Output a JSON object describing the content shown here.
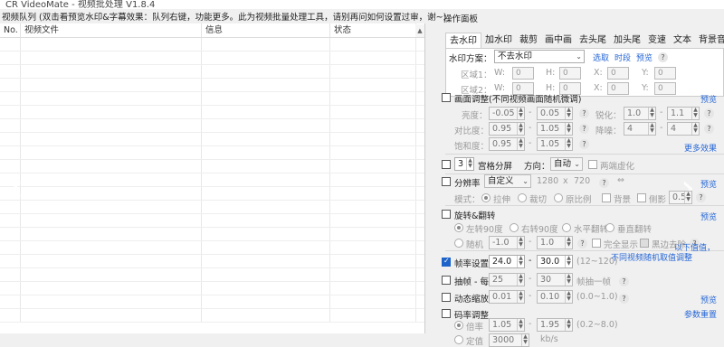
{
  "window": {
    "title": "CR VideoMate - 视频批处理 V1.8.4"
  },
  "queue": {
    "caption": "视频队列 (双击看预览水印&字幕效果：队列右键，功能更多。此为视频批量处理工具，请别再问如何设置过审，谢~)",
    "columns": [
      "No.",
      "视频文件",
      "信息",
      "状态"
    ]
  },
  "panel": {
    "caption": "操作面板",
    "tabs": [
      "去水印",
      "加水印",
      "裁剪",
      "画中画",
      "去头尾",
      "加头尾",
      "变速",
      "文本",
      "背景音"
    ],
    "watermark": {
      "scheme_label": "水印方案：",
      "scheme_value": "不去水印",
      "links": [
        "选取",
        "时段",
        "预览"
      ],
      "area1": "区域1：",
      "area2": "区域2：",
      "w": "W:",
      "h": "H:",
      "x": "X:",
      "y": "Y:",
      "zero": "0"
    },
    "picture": {
      "label": "画面调整(不同视频画面随机微调)",
      "preview": "预览",
      "brightness": "亮度：",
      "b1": "-0.05",
      "b2": "0.05",
      "contrast": "对比度：",
      "c1": "0.95",
      "c2": "1.05",
      "saturation": "饱和度：",
      "s1": "0.95",
      "s2": "1.05",
      "sharpen": "锐化：",
      "sh1": "1.0",
      "sh2": "1.1",
      "denoise": "降噪：",
      "d1": "4",
      "d2": "4",
      "more": "更多效果",
      "dash": "-",
      "q": "?"
    },
    "grid": {
      "value": "3",
      "label": "宫格分屏",
      "dir_label": "方向：",
      "dir_value": "自动",
      "blur": "两端虚化"
    },
    "resolution": {
      "label": "分辨率",
      "value": "自定义",
      "w": "1280",
      "x": "x",
      "h": "720",
      "swap": "⇔",
      "preview": "预览",
      "mode": "模式：",
      "m1": "拉伸",
      "m2": "裁切",
      "m3": "原比例",
      "bg": "背景",
      "side": "侧影",
      "side_val": "0.5"
    },
    "rotate": {
      "label": "旋转&翻转",
      "preview": "预览",
      "r1": "左转90度",
      "r2": "右转90度",
      "r3": "水平翻转",
      "r4": "垂直翻转",
      "random": "随机",
      "v1": "-1.0",
      "v2": "1.0",
      "full": "完全显示",
      "black": "黑边去除"
    },
    "fps": {
      "label": "帧率设置",
      "v1": "24.0",
      "v2": "30.0",
      "range": "(12~120)",
      "note1": "以下值值，",
      "note2": "不同视频随机取值调整"
    },
    "extract": {
      "label": "抽帧 - 每",
      "v1": "25",
      "v2": "30",
      "tail": "帧抽一帧"
    },
    "zoom": {
      "label": "动态缩放",
      "v1": "0.01",
      "v2": "0.10",
      "range": "(0.0~1.0)",
      "preview": "预览"
    },
    "bitrate": {
      "label": "码率调整",
      "reset": "参数重置",
      "times": "倍率",
      "t1": "1.05",
      "t2": "1.95",
      "range": "(0.2~8.0)",
      "fixed": "定值",
      "fixed_val": "3000",
      "unit": "kb/s"
    }
  }
}
